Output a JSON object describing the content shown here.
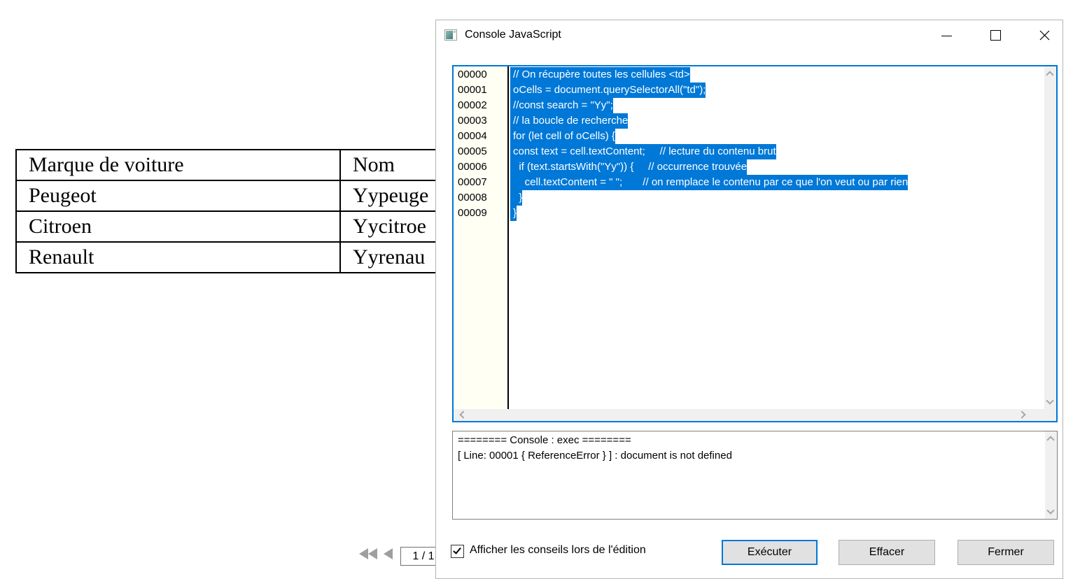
{
  "background": {
    "table": {
      "headers": [
        "Marque de voiture",
        "Nom"
      ],
      "rows": [
        [
          "Peugeot",
          "Yypeuge"
        ],
        [
          "Citroen",
          "Yycitroe"
        ],
        [
          "Renault",
          "Yyrenau"
        ]
      ]
    },
    "pager": {
      "page_indicator": "1 / 1"
    }
  },
  "dialog": {
    "title": "Console JavaScript",
    "editor": {
      "lines": [
        {
          "num": "00000",
          "text": "// On récupère toutes les cellules <td>"
        },
        {
          "num": "00001",
          "text": "oCells = document.querySelectorAll(\"td\");"
        },
        {
          "num": "00002",
          "text": "//const search = \"Yy\";"
        },
        {
          "num": "00003",
          "text": "// la boucle de recherche"
        },
        {
          "num": "00004",
          "text": "for (let cell of oCells) {"
        },
        {
          "num": "00005",
          "text": "const text = cell.textContent;     // lecture du contenu brut"
        },
        {
          "num": "00006",
          "text": "  if (text.startsWith(\"Yy\")) {     // occurrence trouvée"
        },
        {
          "num": "00007",
          "text": "    cell.textContent = \" \";       // on remplace le contenu par ce que l'on veut ou par rien"
        },
        {
          "num": "00008",
          "text": "  }"
        },
        {
          "num": "00009",
          "text": "}"
        }
      ]
    },
    "console": {
      "lines": [
        "======== Console : exec ========",
        "[ Line: 00001 { ReferenceError } ] : document is not defined"
      ]
    },
    "checkbox": {
      "label": "Afficher les conseils lors de l'édition",
      "checked": true
    },
    "buttons": {
      "execute": "Exécuter",
      "clear": "Effacer",
      "close": "Fermer"
    }
  },
  "colors": {
    "accent": "#0078d7",
    "selection_bg": "#0078d7",
    "selection_text": "#ffffff",
    "gutter_bg": "#fffff4",
    "scrollbar_track": "#f0f0f0",
    "scrollbar_arrow": "#a6a6a6",
    "button_bg": "#e1e1e1",
    "button_border": "#adadad",
    "dialog_border": "#b4b4b4",
    "table_border": "#000000"
  }
}
